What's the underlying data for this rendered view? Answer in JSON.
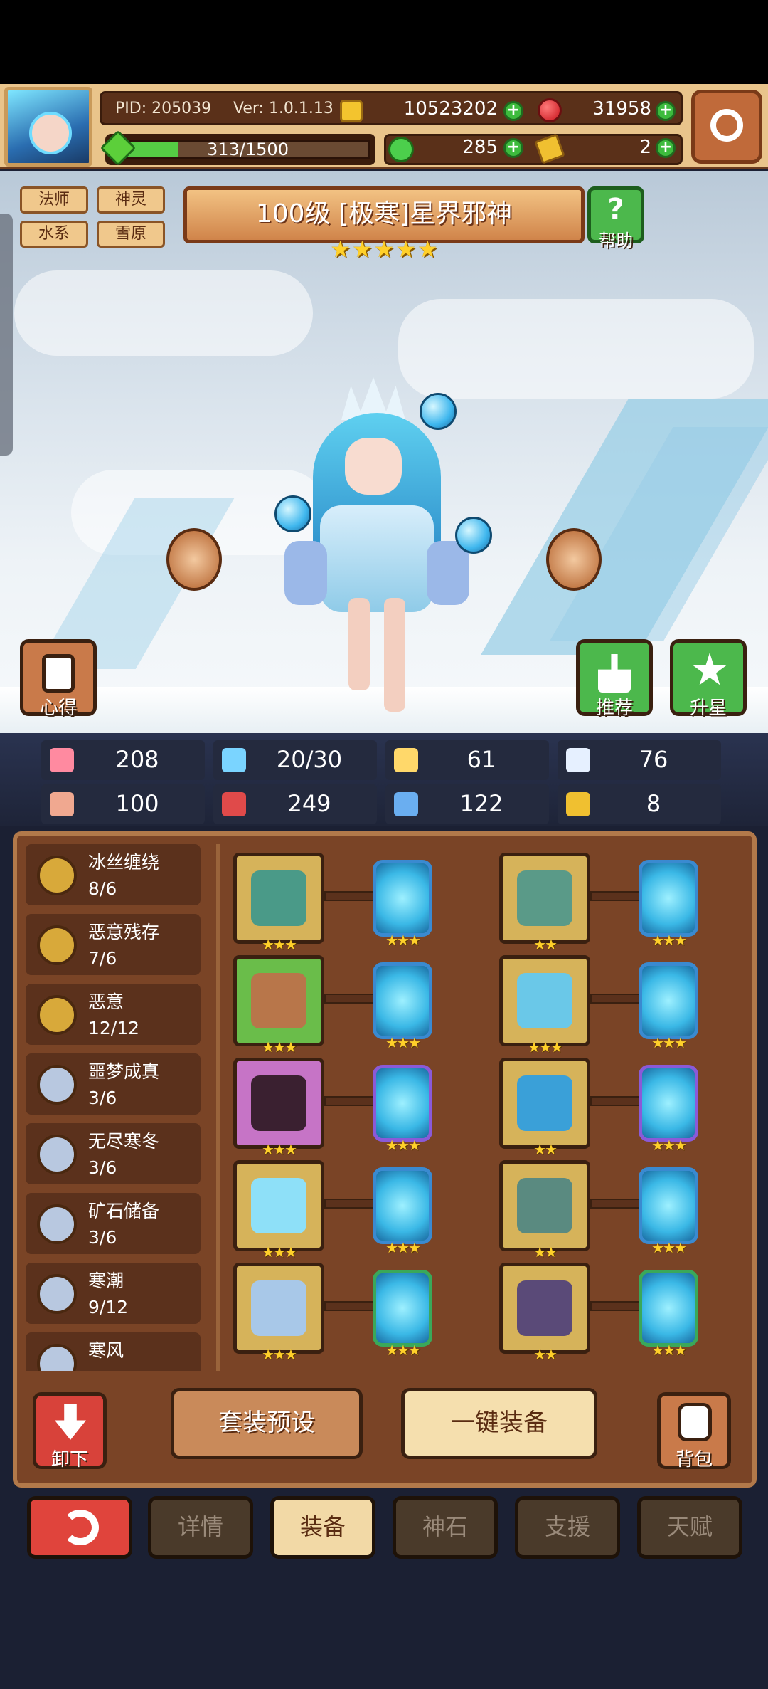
{
  "header": {
    "pid": "PID: 205039",
    "version": "Ver: 1.0.1.13",
    "gold": "10523202",
    "gems": "31958",
    "exp": "313/1500",
    "exp_fraction": 0.2087,
    "clover": "285",
    "ticket": "2"
  },
  "hero": {
    "tags": [
      "法师",
      "神灵",
      "水系",
      "雪原"
    ],
    "title": "100级 [极寒]星界邪神",
    "stars": 5,
    "help_label": "帮助"
  },
  "scene_buttons": {
    "insight": "心得",
    "recommend": "推荐",
    "star_up": "升星"
  },
  "stats": [
    {
      "icon": "heart-icon",
      "value": "208"
    },
    {
      "icon": "water-drop-icon",
      "value": "20/30"
    },
    {
      "icon": "shield-icon",
      "value": "61"
    },
    {
      "icon": "wing-icon",
      "value": "76"
    },
    {
      "icon": "fist-icon",
      "value": "100"
    },
    {
      "icon": "book-icon",
      "value": "249"
    },
    {
      "icon": "scroll-icon",
      "value": "122"
    },
    {
      "icon": "horseshoe-icon",
      "value": "8"
    }
  ],
  "sets": [
    {
      "name": "冰丝缠绕",
      "count": "8/6",
      "color": "#d8a93a"
    },
    {
      "name": "恶意残存",
      "count": "7/6",
      "color": "#d8a93a"
    },
    {
      "name": "恶意",
      "count": "12/12",
      "color": "#d8a93a"
    },
    {
      "name": "噩梦成真",
      "count": "3/6",
      "color": "#b8c8e0"
    },
    {
      "name": "无尽寒冬",
      "count": "3/6",
      "color": "#b8c8e0"
    },
    {
      "name": "矿石储备",
      "count": "3/6",
      "color": "#b8c8e0"
    },
    {
      "name": "寒潮",
      "count": "9/12",
      "color": "#b8c8e0"
    },
    {
      "name": "寒风",
      "count": "",
      "color": "#b8c8e0"
    }
  ],
  "equipment": [
    {
      "slot": "staff",
      "bg": "#d6b35a",
      "stars": "★★★",
      "rune_border": "#3a8ad0",
      "rune_stars": "★★★"
    },
    {
      "slot": "helmet",
      "bg": "#d6b35a",
      "stars": "★★",
      "rune_border": "#3a8ad0",
      "rune_stars": "★★★"
    },
    {
      "slot": "bag",
      "bg": "#6abd4a",
      "stars": "★★★",
      "rune_border": "#3a8ad0",
      "rune_stars": "★★★"
    },
    {
      "slot": "armor",
      "bg": "#d6b35a",
      "stars": "★★★",
      "rune_border": "#3a8ad0",
      "rune_stars": "★★★"
    },
    {
      "slot": "necklace",
      "bg": "#c674c6",
      "stars": "★★★",
      "rune_border": "#8a5ad8",
      "rune_stars": "★★★"
    },
    {
      "slot": "cape",
      "bg": "#d6b35a",
      "stars": "★★",
      "rune_border": "#8a5ad8",
      "rune_stars": "★★★"
    },
    {
      "slot": "crystal",
      "bg": "#d6b35a",
      "stars": "★★★",
      "rune_border": "#3a8ad0",
      "rune_stars": "★★★"
    },
    {
      "slot": "belt",
      "bg": "#d6b35a",
      "stars": "★★",
      "rune_border": "#3a8ad0",
      "rune_stars": "★★★"
    },
    {
      "slot": "ring",
      "bg": "#d6b35a",
      "stars": "★★★",
      "rune_border": "#3aa85a",
      "rune_stars": "★★★"
    },
    {
      "slot": "boots",
      "bg": "#d6b35a",
      "stars": "★★",
      "rune_border": "#3aa85a",
      "rune_stars": "★★★"
    }
  ],
  "actions": {
    "unequip": "卸下",
    "preset": "套装预设",
    "auto_equip": "一键装备",
    "backpack": "背包"
  },
  "tabs": [
    "详情",
    "装备",
    "神石",
    "支援",
    "天赋"
  ],
  "active_tab": 1
}
